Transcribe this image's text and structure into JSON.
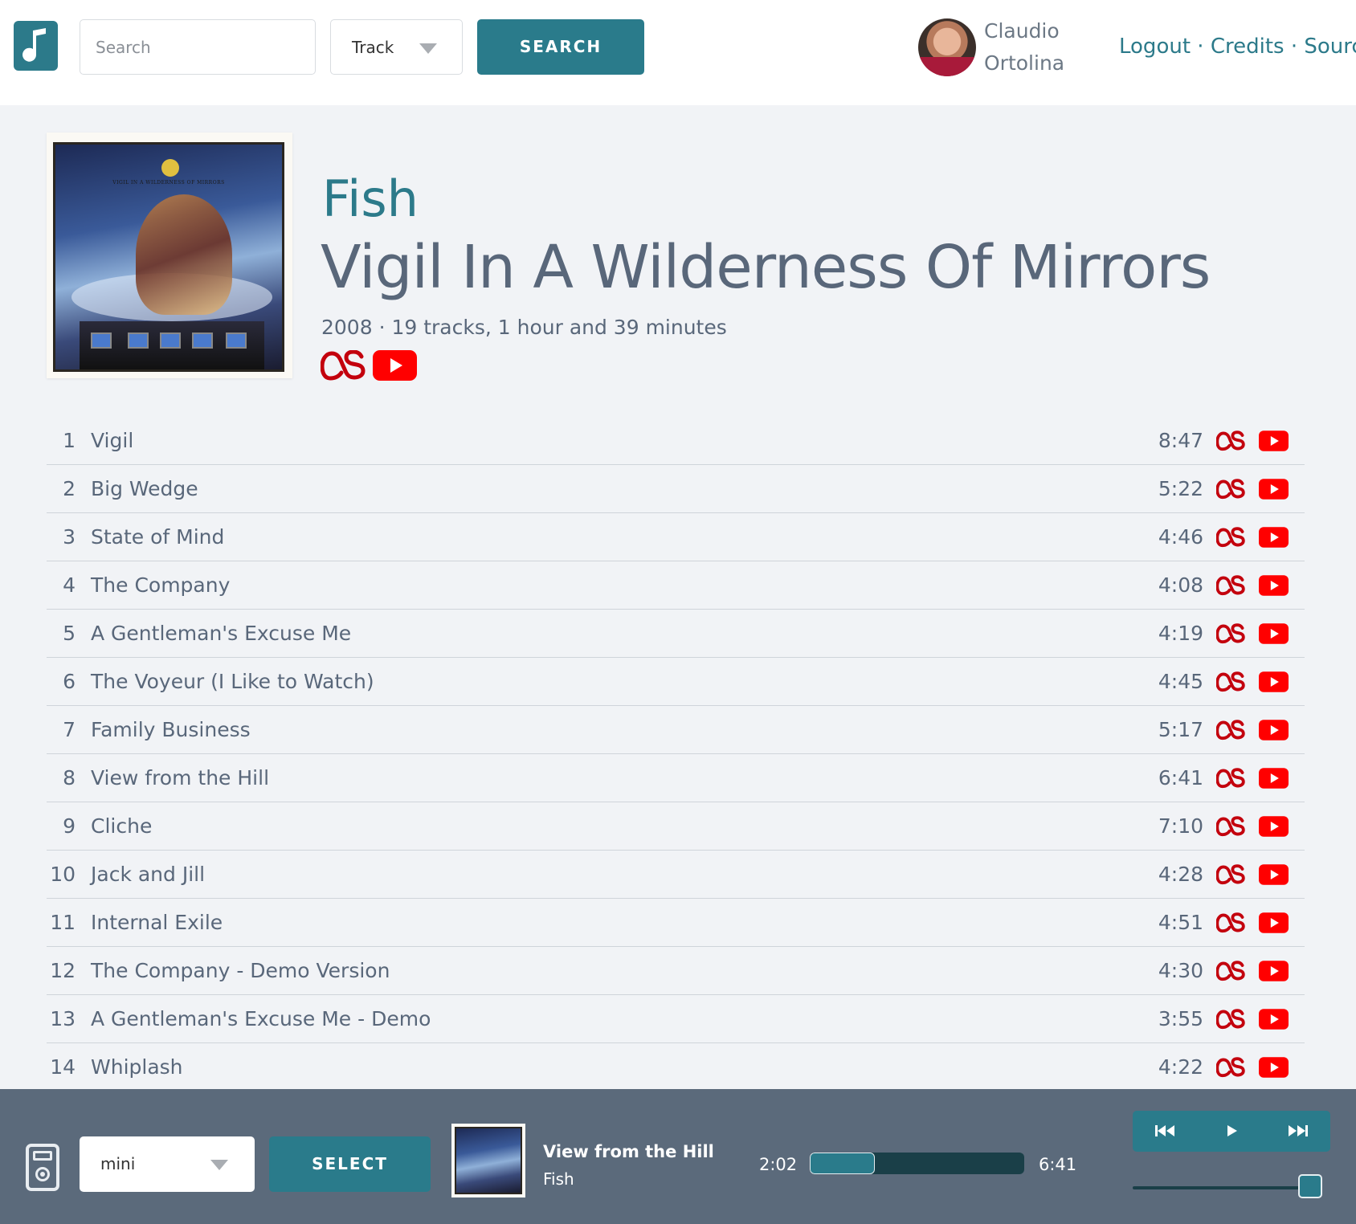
{
  "header": {
    "search_placeholder": "Search",
    "search_type": "Track",
    "search_button": "SEARCH",
    "user": {
      "first_name": "Claudio",
      "last_name": "Ortolina"
    },
    "links": {
      "logout": "Logout",
      "credits": "Credits",
      "source": "Source",
      "separator": "·"
    }
  },
  "album": {
    "artist": "Fish",
    "title": "Vigil In A Wilderness Of Mirrors",
    "meta": "2008 · 19 tracks, 1 hour and 39 minutes",
    "cover_caption": "VIGIL IN A WILDERNESS OF MIRRORS"
  },
  "tracks": [
    {
      "number": "1",
      "title": "Vigil",
      "duration": "8:47"
    },
    {
      "number": "2",
      "title": "Big Wedge",
      "duration": "5:22"
    },
    {
      "number": "3",
      "title": "State of Mind",
      "duration": "4:46"
    },
    {
      "number": "4",
      "title": "The Company",
      "duration": "4:08"
    },
    {
      "number": "5",
      "title": "A Gentleman's Excuse Me",
      "duration": "4:19"
    },
    {
      "number": "6",
      "title": "The Voyeur (I Like to Watch)",
      "duration": "4:45"
    },
    {
      "number": "7",
      "title": "Family Business",
      "duration": "5:17"
    },
    {
      "number": "8",
      "title": "View from the Hill",
      "duration": "6:41"
    },
    {
      "number": "9",
      "title": "Cliche",
      "duration": "7:10"
    },
    {
      "number": "10",
      "title": "Jack and Jill",
      "duration": "4:28"
    },
    {
      "number": "11",
      "title": "Internal Exile",
      "duration": "4:51"
    },
    {
      "number": "12",
      "title": "The Company - Demo Version",
      "duration": "4:30"
    },
    {
      "number": "13",
      "title": "A Gentleman's Excuse Me - Demo",
      "duration": "3:55"
    },
    {
      "number": "14",
      "title": "Whiplash",
      "duration": "4:22"
    }
  ],
  "player": {
    "device": "mini",
    "select_button": "SELECT",
    "now_playing": {
      "title": "View from the Hill",
      "artist": "Fish"
    },
    "elapsed": "2:02",
    "total": "6:41",
    "progress_fraction": 0.304,
    "volume_fraction": 1.0
  },
  "icons": {
    "logo": "music-note-icon",
    "lastfm": "lastfm-icon",
    "youtube": "youtube-icon",
    "device": "ipod-icon",
    "prev": "skip-back-icon",
    "play": "play-icon",
    "next": "skip-forward-icon"
  },
  "colors": {
    "accent": "#2a7b8b",
    "text": "#59677a",
    "background": "#f1f3f6",
    "player_bg": "#5b6a7b",
    "lastfm_red": "#c3000d",
    "youtube_red": "#ff0000"
  }
}
